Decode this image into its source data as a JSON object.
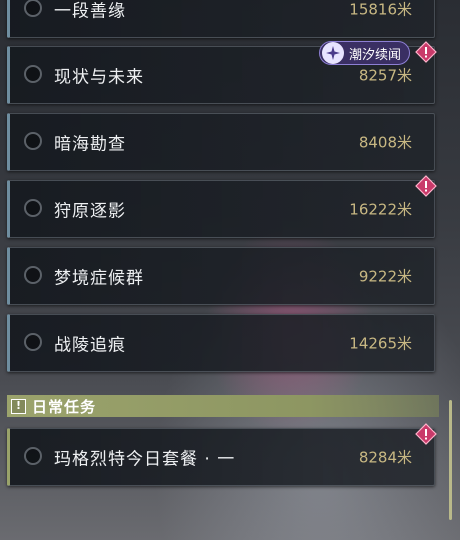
{
  "quests": [
    {
      "name": "一段善缘",
      "distance": "15816米"
    },
    {
      "name": "现状与未来",
      "distance": "8257米",
      "tag": "潮汐续闻"
    },
    {
      "name": "暗海勘查",
      "distance": "8408米"
    },
    {
      "name": "狩原逐影",
      "distance": "16222米"
    },
    {
      "name": "梦境症候群",
      "distance": "9222米"
    },
    {
      "name": "战陵追痕",
      "distance": "14265米"
    }
  ],
  "daily_section": {
    "title": "日常任务",
    "quests": [
      {
        "name": "玛格烈特今日套餐 · 一",
        "distance": "8284米"
      }
    ]
  },
  "icons": {
    "alert": "diamond-alert-icon",
    "tag": "tide-sparkle-icon",
    "section": "exclamation-box-icon"
  },
  "colors": {
    "alert": "#c93a6a",
    "distance": "#c8b883",
    "daily_accent": "#9ba36c",
    "tag_bg": "#3a2f63"
  }
}
